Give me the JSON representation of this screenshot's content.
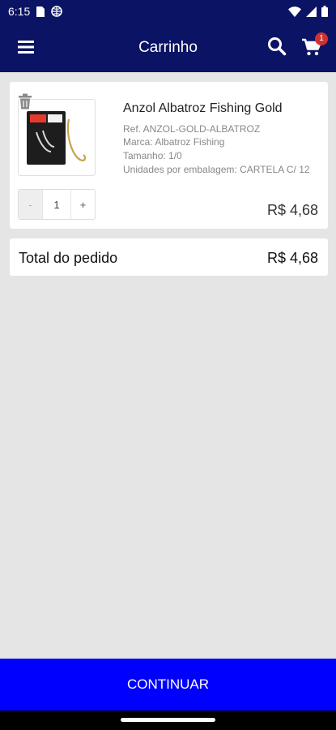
{
  "status_bar": {
    "time": "6:15"
  },
  "app_bar": {
    "title": "Carrinho",
    "cart_count": "1"
  },
  "cart": {
    "item": {
      "name": "Anzol Albatroz Fishing Gold",
      "ref": "Ref. ANZOL-GOLD-ALBATROZ",
      "brand": "Marca: Albatroz Fishing",
      "size": "Tamanho: 1/0",
      "units": "Unidades por embalagem: CARTELA C/ 12",
      "quantity": "1",
      "minus_label": "-",
      "plus_label": "+",
      "price": "R$ 4,68"
    },
    "total_label": "Total do pedido",
    "total_value": "R$ 4,68"
  },
  "footer": {
    "continue_label": "CONTINUAR"
  },
  "colors": {
    "header": "#0b1364",
    "primary_button": "#0000ff",
    "badge": "#d32f2f"
  }
}
